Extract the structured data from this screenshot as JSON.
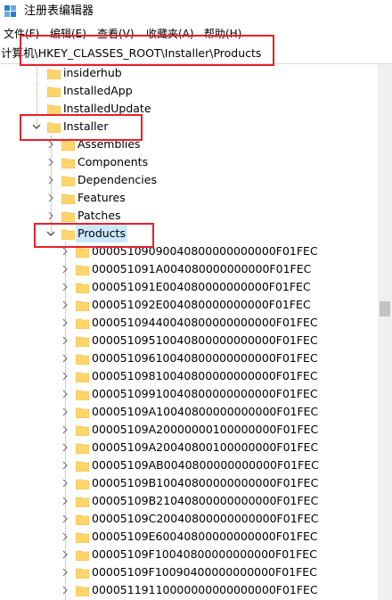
{
  "window": {
    "title": "注册表编辑器"
  },
  "menu": [
    {
      "label": "文件(F)"
    },
    {
      "label": "编辑(E)"
    },
    {
      "label": "查看(V)"
    },
    {
      "label": "收藏夹(A)"
    },
    {
      "label": "帮助(H)"
    }
  ],
  "address": {
    "path": "计算机\\HKEY_CLASSES_ROOT\\Installer\\Products"
  },
  "tree": {
    "siblings_top": [
      {
        "label": "insiderhub"
      },
      {
        "label": "InstalledApp"
      },
      {
        "label": "InstalledUpdate"
      }
    ],
    "installer": {
      "label": "Installer",
      "expanded": true
    },
    "installer_children": [
      {
        "label": "Assemblies"
      },
      {
        "label": "Components"
      },
      {
        "label": "Dependencies"
      },
      {
        "label": "Features"
      },
      {
        "label": "Patches"
      }
    ],
    "products": {
      "label": "Products",
      "expanded": true,
      "selected": true
    },
    "product_keys": [
      {
        "label": "00005109090040800000000000F01FEC"
      },
      {
        "label": "000051091A004080000000000F01FEC"
      },
      {
        "label": "000051091E004080000000000F01FEC"
      },
      {
        "label": "000051092E004080000000000F01FEC"
      },
      {
        "label": "00005109440040800000000000F01FEC"
      },
      {
        "label": "00005109510040800000000000F01FEC"
      },
      {
        "label": "00005109610040800000000000F01FEC"
      },
      {
        "label": "00005109810040800000000000F01FEC"
      },
      {
        "label": "00005109910040800000000000F01FEC"
      },
      {
        "label": "00005109A10040800000000000F01FEC"
      },
      {
        "label": "00005109A20000000100000000F01FEC"
      },
      {
        "label": "00005109A20040800100000000F01FEC"
      },
      {
        "label": "00005109AB0040800000000000F01FEC"
      },
      {
        "label": "00005109B10040800000000000F01FEC"
      },
      {
        "label": "00005109B21040800000000000F01FEC"
      },
      {
        "label": "00005109C20040800000000000F01FEC"
      },
      {
        "label": "00005109E60040800000000000F01FEC"
      },
      {
        "label": "00005109F10040800000000000F01FEC"
      },
      {
        "label": "00005109F10090400000000000F01FEC"
      },
      {
        "label": "00005119110000000000000000F01FEC"
      }
    ]
  },
  "colors": {
    "highlight": "#e8202a",
    "selection": "#cce8ff",
    "folder": "#ffd56b"
  }
}
